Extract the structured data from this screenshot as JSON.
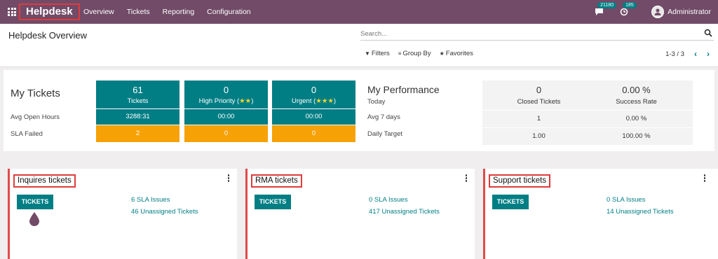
{
  "navbar": {
    "brand": "Helpdesk",
    "menu": [
      "Overview",
      "Tickets",
      "Reporting",
      "Configuration"
    ],
    "messages_count": "21180",
    "activities_count": "185",
    "user": "Administrator"
  },
  "control_panel": {
    "title": "Helpdesk Overview",
    "search_placeholder": "Search...",
    "filters_label": "Filters",
    "groupby_label": "Group By",
    "favorites_label": "Favorites",
    "pager": "1-3 / 3"
  },
  "my_tickets": {
    "title": "My Tickets",
    "row_avg_open": "Avg Open Hours",
    "row_sla_failed": "SLA Failed",
    "tiles": [
      {
        "count": "61",
        "label": "Tickets",
        "stars": "",
        "avg": "3288:31",
        "sla": "2"
      },
      {
        "count": "0",
        "label": "High Priority (",
        "stars": "★★",
        "suffix": ")",
        "avg": "00:00",
        "sla": "0"
      },
      {
        "count": "0",
        "label": "Urgent (",
        "stars": "★★★",
        "suffix": ")",
        "avg": "00:00",
        "sla": "0"
      }
    ]
  },
  "my_performance": {
    "title": "My Performance",
    "row_today": "Today",
    "row_avg7": "Avg 7 days",
    "row_target": "Daily Target",
    "tiles": [
      {
        "value": "0",
        "label": "Closed Tickets",
        "avg7": "1",
        "target": "1.00"
      },
      {
        "value": "0.00 %",
        "label": "Success Rate",
        "avg7": "0.00 %",
        "target": "100.00 %"
      }
    ]
  },
  "teams": [
    {
      "name": "Inquires tickets",
      "button": "TICKETS",
      "sla": "6 SLA Issues",
      "unassigned": "46 Unassigned Tickets"
    },
    {
      "name": "RMA tickets",
      "button": "TICKETS",
      "sla": "0 SLA Issues",
      "unassigned": "417 Unassigned Tickets"
    },
    {
      "name": "Support tickets",
      "button": "TICKETS",
      "sla": "0 SLA Issues",
      "unassigned": "14 Unassigned Tickets"
    }
  ],
  "colors": {
    "brand": "#714b67",
    "teal": "#017e84",
    "orange": "#f6a106",
    "highlight": "#e03b3b"
  }
}
